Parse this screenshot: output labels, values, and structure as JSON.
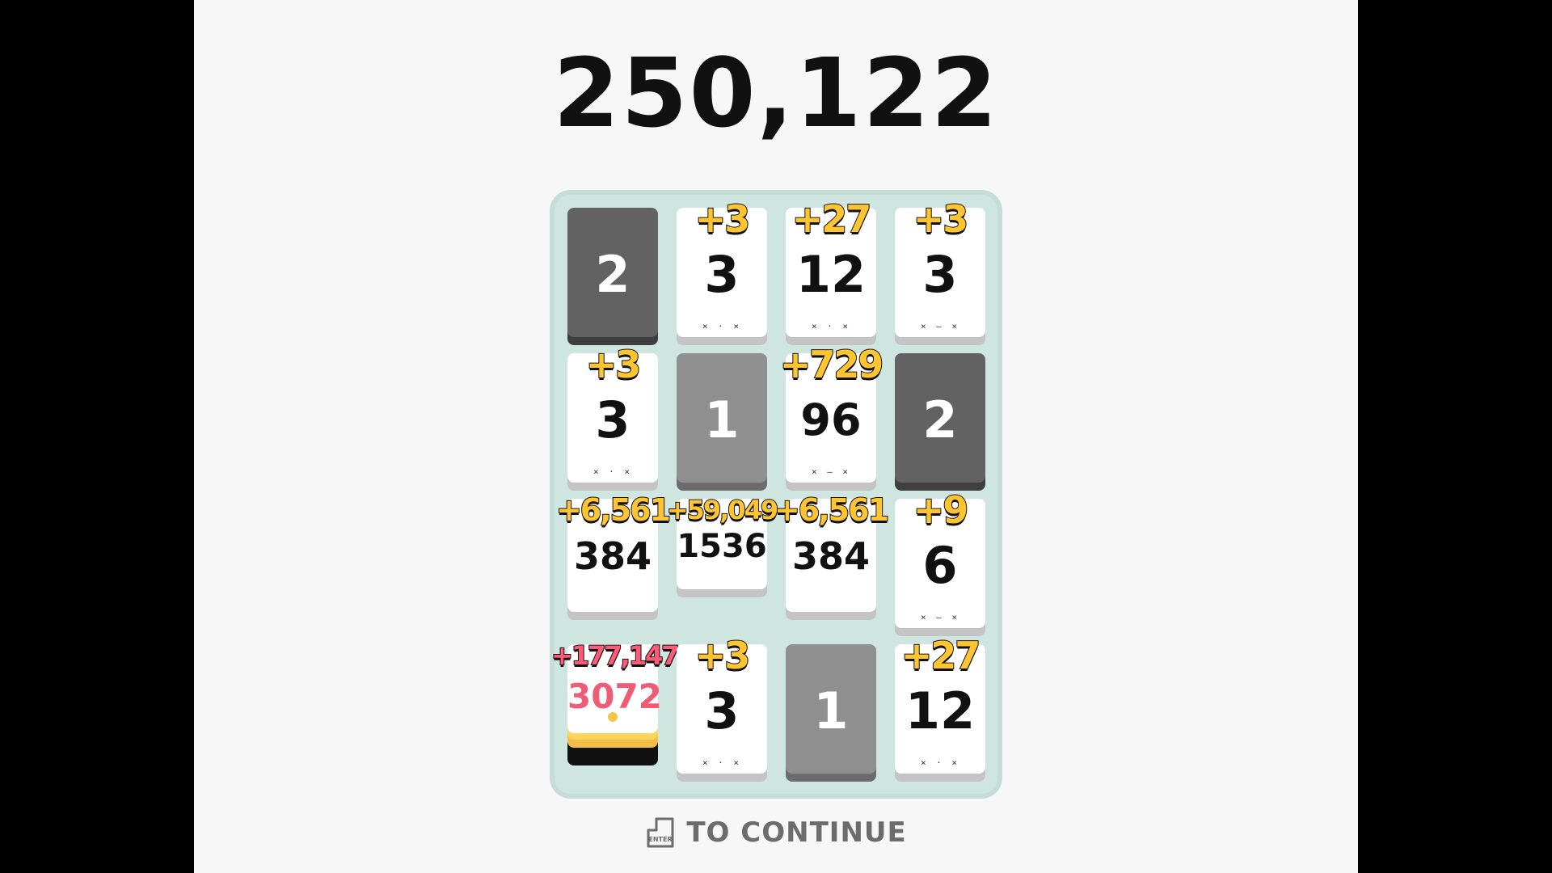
{
  "total_score": "250,122",
  "footer": {
    "enter_key_label": "ENTER",
    "continue_label": "TO CONTINUE"
  },
  "colors": {
    "board_bg": "#cfe6e0",
    "bonus_gold": "#ffc531",
    "bonus_red": "#ff5a78",
    "one_card": "#8f8f8f",
    "two_card": "#626262"
  },
  "board": {
    "rows": [
      [
        {
          "value": "2",
          "bonus": "",
          "type": "dark"
        },
        {
          "value": "3",
          "bonus": "+3",
          "type": "white"
        },
        {
          "value": "12",
          "bonus": "+27",
          "type": "white"
        },
        {
          "value": "3",
          "bonus": "+3",
          "type": "white"
        }
      ],
      [
        {
          "value": "3",
          "bonus": "+3",
          "type": "white"
        },
        {
          "value": "1",
          "bonus": "",
          "type": "gray"
        },
        {
          "value": "96",
          "bonus": "+729",
          "type": "white"
        },
        {
          "value": "2",
          "bonus": "",
          "type": "dark"
        }
      ],
      [
        {
          "value": "384",
          "bonus": "+6,561",
          "type": "white"
        },
        {
          "value": "1536",
          "bonus": "+59,049",
          "type": "white"
        },
        {
          "value": "384",
          "bonus": "+6,561",
          "type": "white"
        },
        {
          "value": "6",
          "bonus": "+9",
          "type": "white"
        }
      ],
      [
        {
          "value": "3072",
          "bonus": "+177,147",
          "type": "pink"
        },
        {
          "value": "3",
          "bonus": "+3",
          "type": "white"
        },
        {
          "value": "1",
          "bonus": "",
          "type": "gray"
        },
        {
          "value": "12",
          "bonus": "+27",
          "type": "white"
        }
      ]
    ]
  }
}
